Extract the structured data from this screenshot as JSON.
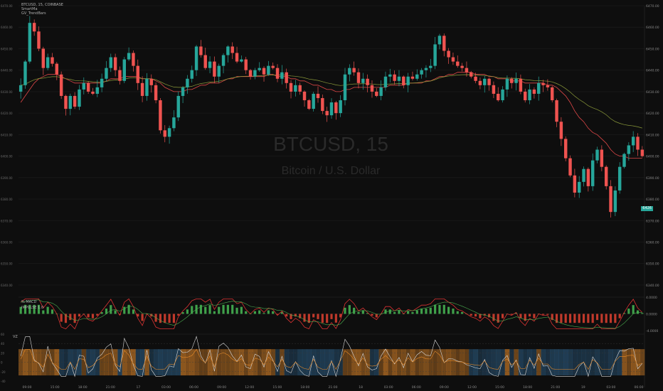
{
  "header": {
    "symbol_line": "BTCUSD, 15, COINBASE",
    "indicators": [
      "SmartMa",
      "GV_TrendBars"
    ]
  },
  "watermark": {
    "ticker": "BTCUSD, 15",
    "description": "Bitcoin / U.S. Dollar"
  },
  "macd_panel": {
    "label_1": "% MACD",
    "label_2": "IMPULSE 1.0"
  },
  "vz_panel": {
    "label": "VZ"
  },
  "price_tag": "6426",
  "colors": {
    "background": "#0e0e0e",
    "grid": "#1d1d1d",
    "up": "#26a69a",
    "down": "#ef5350",
    "ma_fast": "#e04848",
    "ma_slow": "#8b9a3a",
    "vz_orange": "#e58a2a",
    "vz_blue": "#2d5f86",
    "vz_line": "#d8d8d8"
  },
  "chart_data": [
    {
      "type": "candlestick",
      "title": "BTCUSD, 15, COINBASE",
      "ylim": [
        6337,
        6470
      ],
      "x_tick_labels": [
        "09:00",
        "15:00",
        "18:00",
        "21:00",
        "17",
        "03:00",
        "06:00",
        "09:00",
        "12:00",
        "15:00",
        "18:00",
        "21:00",
        "18",
        "03:00",
        "06:00",
        "09:00",
        "12:00",
        "15:00",
        "18:00",
        "21:00",
        "19",
        "03:00",
        "06:00"
      ],
      "y_tick_labels": [
        "6340.00",
        "6350.00",
        "6360.00",
        "6370.00",
        "6380.00",
        "6390.00",
        "6400.00",
        "6410.00",
        "6420.00",
        "6430.00",
        "6440.00",
        "6450.00",
        "6460.00",
        "6470.00"
      ],
      "close": [
        6433,
        6444,
        6462,
        6458,
        6450,
        6441,
        6446,
        6443,
        6438,
        6428,
        6422,
        6428,
        6423,
        6431,
        6434,
        6430,
        6429,
        6432,
        6436,
        6441,
        6446,
        6440,
        6435,
        6445,
        6448,
        6442,
        6434,
        6428,
        6436,
        6433,
        6426,
        6412,
        6409,
        6413,
        6418,
        6428,
        6432,
        6436,
        6440,
        6451,
        6447,
        6441,
        6444,
        6437,
        6442,
        6447,
        6451,
        6448,
        6444,
        6445,
        6440,
        6437,
        6440,
        6441,
        6438,
        6442,
        6441,
        6436,
        6439,
        6434,
        6430,
        6433,
        6430,
        6426,
        6422,
        6429,
        6427,
        6421,
        6419,
        6425,
        6420,
        6426,
        6438,
        6441,
        6439,
        6434,
        6436,
        6433,
        6430,
        6428,
        6432,
        6437,
        6438,
        6435,
        6437,
        6433,
        6437,
        6436,
        6438,
        6440,
        6441,
        6442,
        6452,
        6456,
        6449,
        6446,
        6444,
        6442,
        6441,
        6439,
        6437,
        6435,
        6433,
        6436,
        6433,
        6429,
        6426,
        6431,
        6436,
        6434,
        6436,
        6430,
        6426,
        6431,
        6429,
        6434,
        6433,
        6432,
        6426,
        6416,
        6408,
        6399,
        6391,
        6383,
        6388,
        6394,
        6386,
        6398,
        6403,
        6395,
        6386,
        6374,
        6384,
        6395,
        6401,
        6405,
        6409,
        6403,
        6400
      ],
      "series": [
        {
          "name": "SmartMa",
          "values": [
            6425,
            6428,
            6431,
            6434,
            6436,
            6437,
            6438,
            6438,
            6438,
            6437,
            6436,
            6435,
            6434,
            6434,
            6434,
            6434,
            6434,
            6434,
            6434,
            6435,
            6436,
            6436,
            6436,
            6437,
            6437,
            6437,
            6437,
            6436,
            6436,
            6436,
            6435,
            6434,
            6432,
            6431,
            6430,
            6430,
            6430,
            6431,
            6431,
            6432,
            6433,
            6433,
            6434,
            6434,
            6434,
            6435,
            6436,
            6436,
            6437,
            6437,
            6437,
            6437,
            6437,
            6437,
            6437,
            6438,
            6438,
            6437,
            6437,
            6437,
            6436,
            6436,
            6435,
            6435,
            6434,
            6433,
            6433,
            6432,
            6431,
            6431,
            6430,
            6430,
            6431,
            6431,
            6432,
            6432,
            6432,
            6432,
            6432,
            6432,
            6432,
            6432,
            6433,
            6433,
            6433,
            6433,
            6434,
            6434,
            6434,
            6434,
            6435,
            6435,
            6436,
            6437,
            6437,
            6438,
            6438,
            6439,
            6439,
            6439,
            6439,
            6438,
            6438,
            6438,
            6437,
            6437,
            6436,
            6436,
            6436,
            6435,
            6435,
            6435,
            6434,
            6434,
            6434,
            6434,
            6434,
            6433,
            6433,
            6432,
            6430,
            6428,
            6425,
            6421,
            6418,
            6416,
            6413,
            6411,
            6410,
            6408,
            6406,
            6403,
            6401,
            6400,
            6400,
            6399,
            6399,
            6399,
            6399
          ]
        }
      ]
    },
    {
      "type": "bar",
      "title": "% MACD",
      "ylim": [
        -4,
        4
      ],
      "y_tick_labels": [
        "4.0000",
        "0.0000",
        "-4.0000"
      ]
    },
    {
      "type": "line",
      "title": "VZ",
      "ylim": [
        -40,
        60
      ],
      "y_tick_labels": [
        "60",
        "40",
        "20",
        "0",
        "-20",
        "-40"
      ]
    }
  ]
}
